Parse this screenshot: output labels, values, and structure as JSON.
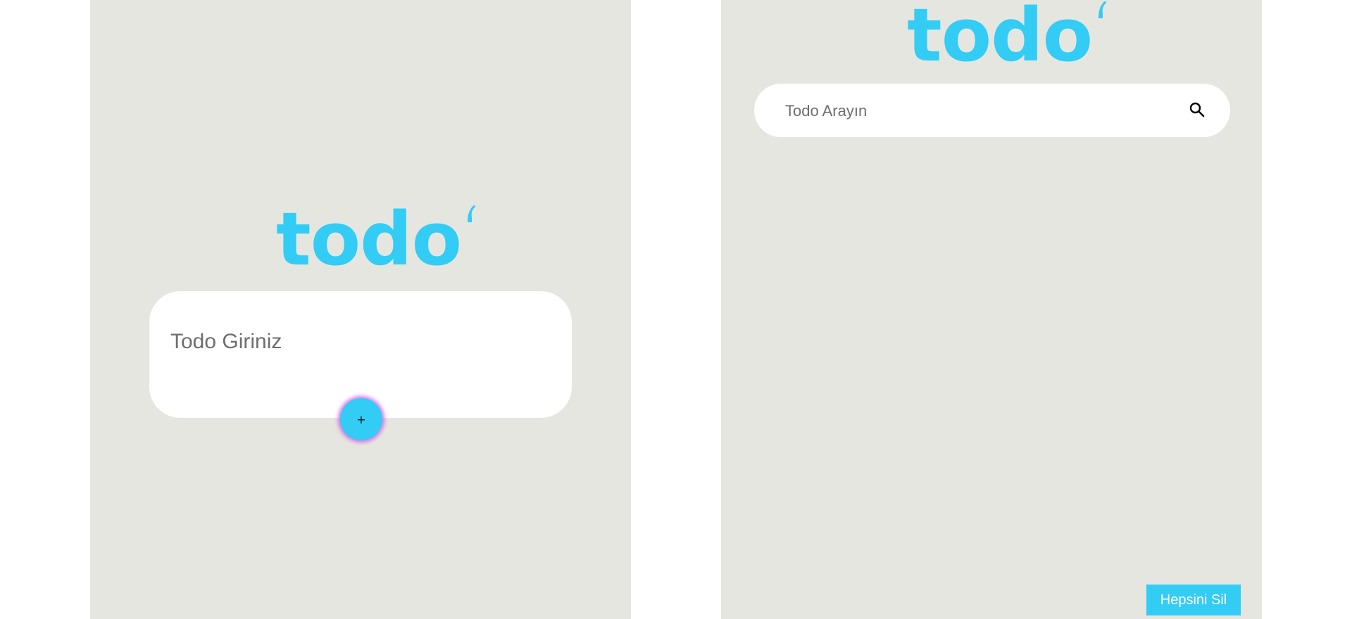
{
  "colors": {
    "accent": "#33ccf5",
    "panel_background": "#e6e6e1",
    "card_background": "#ffffff",
    "placeholder_text": "#6e6e6e",
    "add_button_glow": "#c850e6"
  },
  "left_panel": {
    "logo_text": "todo",
    "input": {
      "value": "",
      "placeholder": "Todo Giriniz"
    },
    "add_button_label": "+"
  },
  "right_panel": {
    "logo_text": "todo",
    "search": {
      "value": "",
      "placeholder": "Todo Arayın",
      "icon": "search-icon"
    },
    "clear_all_label": "Hepsini Sil"
  }
}
